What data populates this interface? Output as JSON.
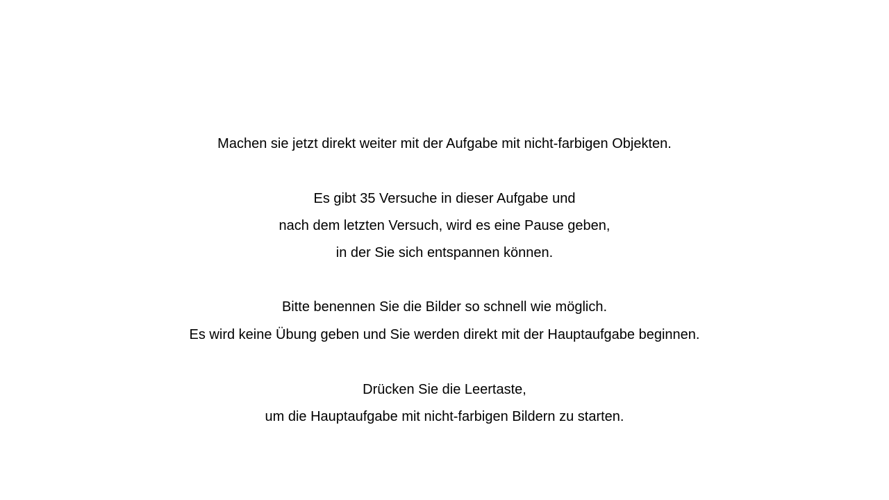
{
  "instructions": {
    "intro": "Machen sie jetzt direkt weiter mit der Aufgabe mit nicht-farbigen Objekten.",
    "trials_line1": "Es gibt 35 Versuche in dieser Aufgabe und",
    "trials_line2": "nach dem letzten Versuch, wird es eine Pause geben,",
    "trials_line3": "in der Sie sich entspannen können.",
    "naming_line1": "Bitte benennen Sie die Bilder so schnell wie möglich.",
    "naming_line2": "Es wird keine Übung geben und Sie werden direkt mit der Hauptaufgabe beginnen.",
    "start_line1": "Drücken Sie die Leertaste,",
    "start_line2": "um die Hauptaufgabe mit nicht-farbigen Bildern zu starten."
  }
}
